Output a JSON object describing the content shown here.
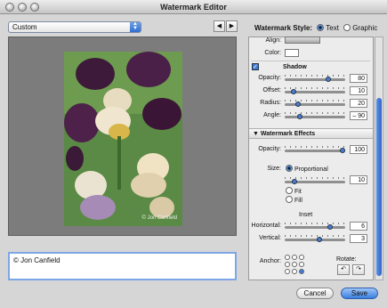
{
  "window": {
    "title": "Watermark Editor"
  },
  "preset": {
    "selected": "Custom"
  },
  "nav": {
    "prev": "◀",
    "next": "▶"
  },
  "preview": {
    "watermark_text": "© Jon Canfield"
  },
  "text_field": {
    "value": "© Jon Canfield"
  },
  "style": {
    "label": "Watermark Style:",
    "text_option": "Text",
    "graphic_option": "Graphic",
    "selected": "Text"
  },
  "text_settings": {
    "align_label": "Align:",
    "color_label": "Color:"
  },
  "shadow": {
    "label": "Shadow",
    "checked": true,
    "opacity": {
      "label": "Opacity:",
      "value": "80"
    },
    "offset": {
      "label": "Offset:",
      "value": "10"
    },
    "radius": {
      "label": "Radius:",
      "value": "20"
    },
    "angle": {
      "label": "Angle:",
      "value": "– 90"
    }
  },
  "effects": {
    "header": "Watermark Effects",
    "opacity": {
      "label": "Opacity:",
      "value": "100"
    },
    "size": {
      "label": "Size:",
      "options": [
        "Proportional",
        "Fit",
        "Fill"
      ],
      "selected": "Proportional",
      "value": "10"
    },
    "inset": {
      "label": "Inset",
      "horizontal_label": "Horizontal:",
      "horizontal_value": "6",
      "vertical_label": "Vertical:",
      "vertical_value": "3"
    },
    "anchor_label": "Anchor:",
    "rotate_label": "Rotate:"
  },
  "buttons": {
    "cancel": "Cancel",
    "save": "Save"
  }
}
